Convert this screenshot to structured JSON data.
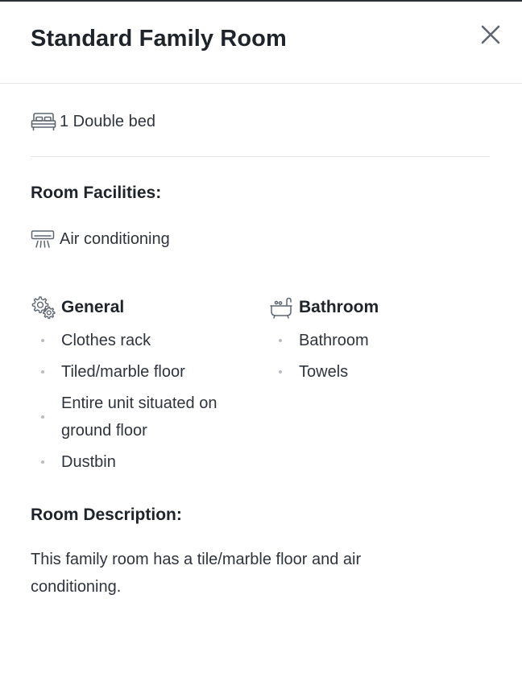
{
  "room": {
    "title": "Standard Family Room",
    "bed": "1 Double bed"
  },
  "facilities": {
    "heading": "Room Facilities:",
    "highlight": "Air conditioning",
    "general": {
      "label": "General",
      "items": [
        "Clothes rack",
        "Tiled/marble floor",
        "Entire unit situated on ground floor",
        "Dustbin"
      ]
    },
    "bathroom": {
      "label": "Bathroom",
      "items": [
        "Bathroom",
        "Towels"
      ]
    }
  },
  "description": {
    "heading": "Room Description:",
    "text": "This family room has a tile/marble floor and air conditioning."
  },
  "icons": {
    "close": "close-icon",
    "bed": "bed-icon",
    "air_conditioning": "air-conditioner-icon",
    "general": "gears-icon",
    "bathroom": "bathtub-icon"
  },
  "colors": {
    "text": "#262b33",
    "muted_icon": "#5f6670",
    "divider": "#e1e3e6",
    "bullet": "#b9bdc3"
  }
}
